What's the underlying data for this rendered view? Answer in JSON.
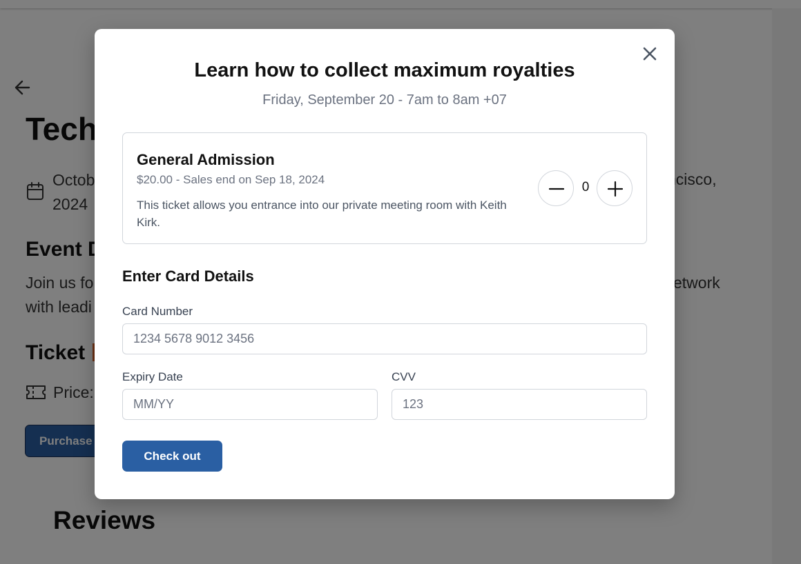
{
  "background": {
    "title": "Tech",
    "date": "Octob 2024",
    "location": "ncisco,",
    "event_heading": "Event D",
    "description_start": "Join us fo with leadi",
    "description_end": "etwork",
    "ticket_heading": "Ticket",
    "price_label": "Price:",
    "purchase_button": "Purchase",
    "reviews_heading": "Reviews",
    "colors": {
      "accent": "#d9622b",
      "primary": "#2a5fa3"
    }
  },
  "modal": {
    "title": "Learn how to collect maximum royalties",
    "subtitle": "Friday, September 20 - 7am to 8am +07",
    "ticket": {
      "name": "General Admission",
      "meta": "$20.00 - Sales end on Sep 18, 2024",
      "description": "This ticket allows you entrance into our private meeting room with Keith Kirk.",
      "quantity": "0"
    },
    "card_section_title": "Enter Card Details",
    "card_number": {
      "label": "Card Number",
      "placeholder": "1234 5678 9012 3456"
    },
    "expiry": {
      "label": "Expiry Date",
      "placeholder": "MM/YY"
    },
    "cvv": {
      "label": "CVV",
      "placeholder": "123"
    },
    "checkout_label": "Check out",
    "icons": {
      "close": "close-icon",
      "minus": "minus-icon",
      "plus": "plus-icon"
    }
  }
}
